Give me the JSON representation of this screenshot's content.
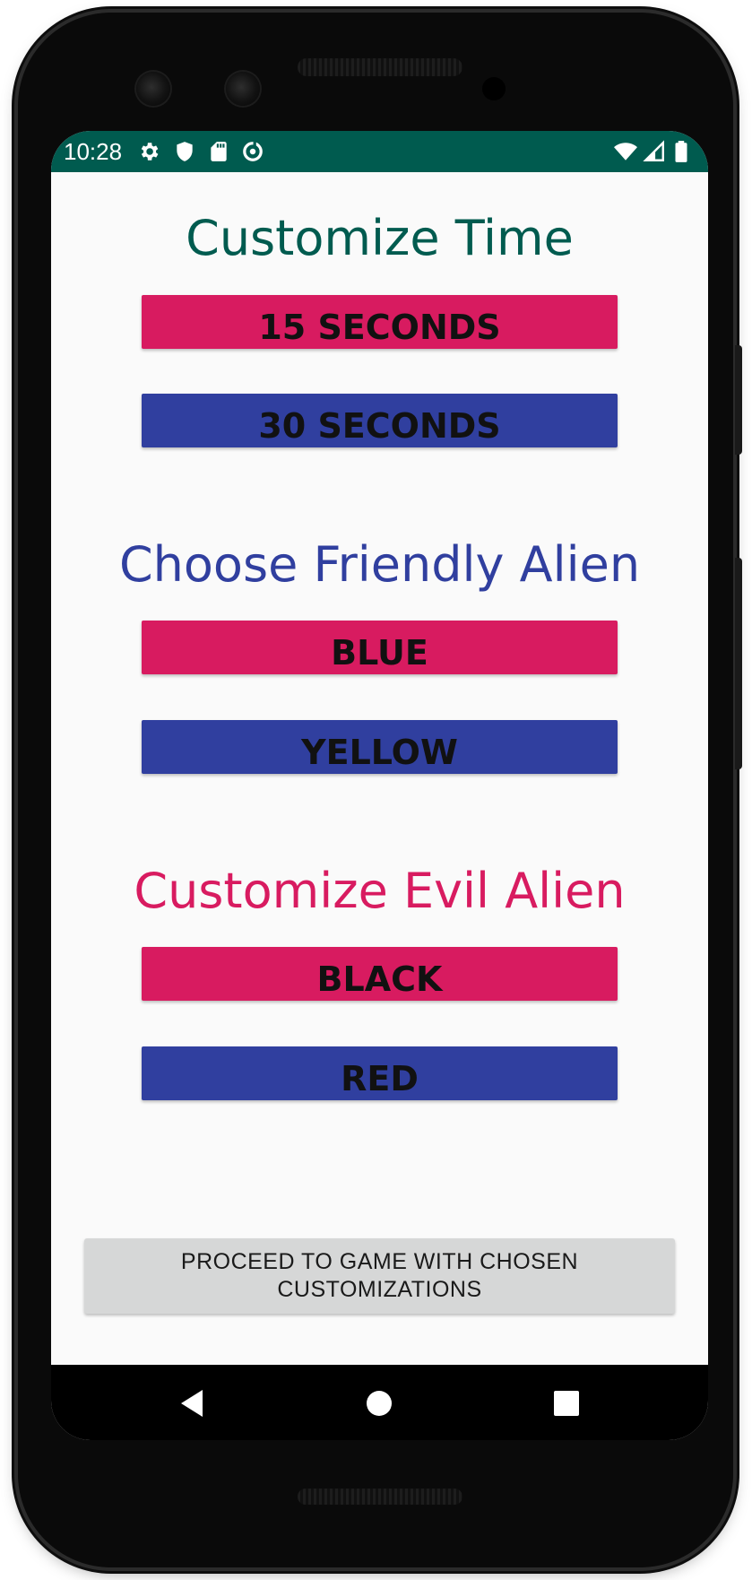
{
  "status_bar": {
    "time": "10:28",
    "left_icons": [
      "settings-icon",
      "shield-icon",
      "sd-card-icon",
      "data-saver-icon"
    ],
    "right_icons": [
      "wifi-icon",
      "cellular-signal-icon",
      "battery-icon"
    ],
    "background_color": "#005b4f"
  },
  "time_section": {
    "heading": "Customize Time",
    "heading_color": "#005b4f",
    "option_1": "15 SECONDS",
    "option_2": "30 SECONDS"
  },
  "friendly_section": {
    "heading": "Choose Friendly Alien",
    "heading_color": "#303f9f",
    "option_1": "BLUE",
    "option_2": "YELLOW"
  },
  "evil_section": {
    "heading": "Customize Evil Alien",
    "heading_color": "#d81b60",
    "option_1": "BLACK",
    "option_2": "RED"
  },
  "proceed_button": {
    "line_1": "PROCEED TO GAME WITH CHOSEN",
    "line_2": "CUSTOMIZATIONS"
  },
  "colors": {
    "pink_button": "#d81b60",
    "indigo_button": "#303f9f",
    "screen_background": "#fafafa"
  },
  "nav_bar": {
    "buttons": [
      "back-icon",
      "home-icon",
      "recents-icon"
    ]
  }
}
